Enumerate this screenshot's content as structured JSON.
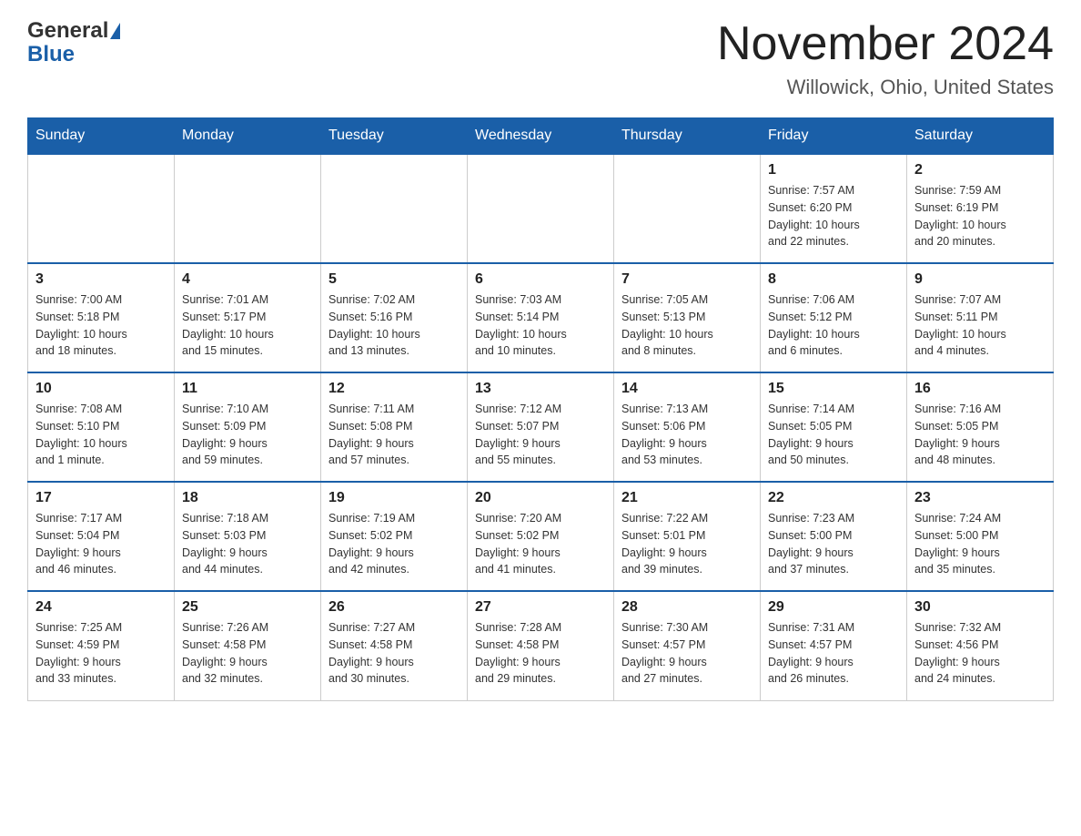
{
  "logo": {
    "general": "General",
    "blue": "Blue"
  },
  "title": "November 2024",
  "subtitle": "Willowick, Ohio, United States",
  "weekdays": [
    "Sunday",
    "Monday",
    "Tuesday",
    "Wednesday",
    "Thursday",
    "Friday",
    "Saturday"
  ],
  "weeks": [
    [
      {
        "day": "",
        "info": ""
      },
      {
        "day": "",
        "info": ""
      },
      {
        "day": "",
        "info": ""
      },
      {
        "day": "",
        "info": ""
      },
      {
        "day": "",
        "info": ""
      },
      {
        "day": "1",
        "info": "Sunrise: 7:57 AM\nSunset: 6:20 PM\nDaylight: 10 hours\nand 22 minutes."
      },
      {
        "day": "2",
        "info": "Sunrise: 7:59 AM\nSunset: 6:19 PM\nDaylight: 10 hours\nand 20 minutes."
      }
    ],
    [
      {
        "day": "3",
        "info": "Sunrise: 7:00 AM\nSunset: 5:18 PM\nDaylight: 10 hours\nand 18 minutes."
      },
      {
        "day": "4",
        "info": "Sunrise: 7:01 AM\nSunset: 5:17 PM\nDaylight: 10 hours\nand 15 minutes."
      },
      {
        "day": "5",
        "info": "Sunrise: 7:02 AM\nSunset: 5:16 PM\nDaylight: 10 hours\nand 13 minutes."
      },
      {
        "day": "6",
        "info": "Sunrise: 7:03 AM\nSunset: 5:14 PM\nDaylight: 10 hours\nand 10 minutes."
      },
      {
        "day": "7",
        "info": "Sunrise: 7:05 AM\nSunset: 5:13 PM\nDaylight: 10 hours\nand 8 minutes."
      },
      {
        "day": "8",
        "info": "Sunrise: 7:06 AM\nSunset: 5:12 PM\nDaylight: 10 hours\nand 6 minutes."
      },
      {
        "day": "9",
        "info": "Sunrise: 7:07 AM\nSunset: 5:11 PM\nDaylight: 10 hours\nand 4 minutes."
      }
    ],
    [
      {
        "day": "10",
        "info": "Sunrise: 7:08 AM\nSunset: 5:10 PM\nDaylight: 10 hours\nand 1 minute."
      },
      {
        "day": "11",
        "info": "Sunrise: 7:10 AM\nSunset: 5:09 PM\nDaylight: 9 hours\nand 59 minutes."
      },
      {
        "day": "12",
        "info": "Sunrise: 7:11 AM\nSunset: 5:08 PM\nDaylight: 9 hours\nand 57 minutes."
      },
      {
        "day": "13",
        "info": "Sunrise: 7:12 AM\nSunset: 5:07 PM\nDaylight: 9 hours\nand 55 minutes."
      },
      {
        "day": "14",
        "info": "Sunrise: 7:13 AM\nSunset: 5:06 PM\nDaylight: 9 hours\nand 53 minutes."
      },
      {
        "day": "15",
        "info": "Sunrise: 7:14 AM\nSunset: 5:05 PM\nDaylight: 9 hours\nand 50 minutes."
      },
      {
        "day": "16",
        "info": "Sunrise: 7:16 AM\nSunset: 5:05 PM\nDaylight: 9 hours\nand 48 minutes."
      }
    ],
    [
      {
        "day": "17",
        "info": "Sunrise: 7:17 AM\nSunset: 5:04 PM\nDaylight: 9 hours\nand 46 minutes."
      },
      {
        "day": "18",
        "info": "Sunrise: 7:18 AM\nSunset: 5:03 PM\nDaylight: 9 hours\nand 44 minutes."
      },
      {
        "day": "19",
        "info": "Sunrise: 7:19 AM\nSunset: 5:02 PM\nDaylight: 9 hours\nand 42 minutes."
      },
      {
        "day": "20",
        "info": "Sunrise: 7:20 AM\nSunset: 5:02 PM\nDaylight: 9 hours\nand 41 minutes."
      },
      {
        "day": "21",
        "info": "Sunrise: 7:22 AM\nSunset: 5:01 PM\nDaylight: 9 hours\nand 39 minutes."
      },
      {
        "day": "22",
        "info": "Sunrise: 7:23 AM\nSunset: 5:00 PM\nDaylight: 9 hours\nand 37 minutes."
      },
      {
        "day": "23",
        "info": "Sunrise: 7:24 AM\nSunset: 5:00 PM\nDaylight: 9 hours\nand 35 minutes."
      }
    ],
    [
      {
        "day": "24",
        "info": "Sunrise: 7:25 AM\nSunset: 4:59 PM\nDaylight: 9 hours\nand 33 minutes."
      },
      {
        "day": "25",
        "info": "Sunrise: 7:26 AM\nSunset: 4:58 PM\nDaylight: 9 hours\nand 32 minutes."
      },
      {
        "day": "26",
        "info": "Sunrise: 7:27 AM\nSunset: 4:58 PM\nDaylight: 9 hours\nand 30 minutes."
      },
      {
        "day": "27",
        "info": "Sunrise: 7:28 AM\nSunset: 4:58 PM\nDaylight: 9 hours\nand 29 minutes."
      },
      {
        "day": "28",
        "info": "Sunrise: 7:30 AM\nSunset: 4:57 PM\nDaylight: 9 hours\nand 27 minutes."
      },
      {
        "day": "29",
        "info": "Sunrise: 7:31 AM\nSunset: 4:57 PM\nDaylight: 9 hours\nand 26 minutes."
      },
      {
        "day": "30",
        "info": "Sunrise: 7:32 AM\nSunset: 4:56 PM\nDaylight: 9 hours\nand 24 minutes."
      }
    ]
  ]
}
